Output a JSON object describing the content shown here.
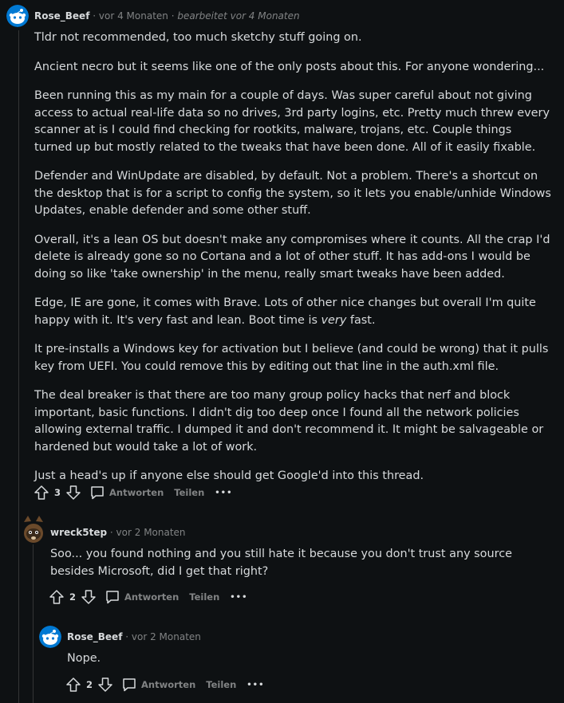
{
  "comments": [
    {
      "user": "Rose_Beef",
      "time": "vor 4 Monaten",
      "edited": "bearbeitet vor 4 Monaten",
      "paragraphs": [
        "Tldr not recommended, too much sketchy stuff going on.",
        "Ancient necro but it seems like one of the only posts about this. For anyone wondering...",
        "Been running this as my main for a couple of days. Was super careful about not giving access to actual real-life data so no drives, 3rd party logins, etc. Pretty much threw every scanner at is I could find checking for rootkits, malware, trojans, etc. Couple things turned up but mostly related to the tweaks that have been done. All of it easily fixable.",
        "Defender and WinUpdate are disabled, by default. Not a problem. There's a shortcut on the desktop that is for a script to config the system, so it lets you enable/unhide Windows Updates, enable defender and some other stuff.",
        "Overall, it's a lean OS but doesn't make any compromises where it counts. All the crap I'd delete is already gone so no Cortana and a lot of other stuff. It has add-ons I would be doing so like 'take ownership' in the menu, really smart tweaks have been added.",
        "Edge, IE are gone, it comes with Brave. Lots of other nice changes but overall I'm quite happy with it. It's very fast and lean. Boot time is ",
        "It pre-installs a Windows key for activation but I believe (and could be wrong) that it pulls key from UEFI. You could remove this by editing out that line in the auth.xml file.",
        "The deal breaker is that there are too many group policy hacks that nerf and block important, basic functions. I didn't dig too deep once I found all the network policies allowing external traffic. I dumped it and don't recommend it. It might be salvageable or hardened but would take a lot of work.",
        "Just a head's up if anyone else should get Google'd into this thread."
      ],
      "p6_emph": "very",
      "p6_tail": " fast.",
      "score": "3"
    },
    {
      "user": "wreck5tep",
      "time": "vor 2 Monaten",
      "paragraphs": [
        "Soo... you found nothing and you still hate it because you don't trust any source besides Microsoft, did I get that right?"
      ],
      "score": "2"
    },
    {
      "user": "Rose_Beef",
      "time": "vor 2 Monaten",
      "paragraphs": [
        "Nope."
      ],
      "score": "2"
    }
  ],
  "labels": {
    "reply": "Antworten",
    "share": "Teilen",
    "more": "•••",
    "sep": "·"
  },
  "colors": {
    "background": "#0e1113",
    "text": "#d7dadc",
    "muted": "#818384",
    "thread_line": "#343536",
    "avatar_blue": "#0079d3"
  },
  "icons": [
    "upvote-icon",
    "downvote-icon",
    "comment-icon",
    "more-icon",
    "snoo-avatar",
    "raccoon-avatar"
  ]
}
